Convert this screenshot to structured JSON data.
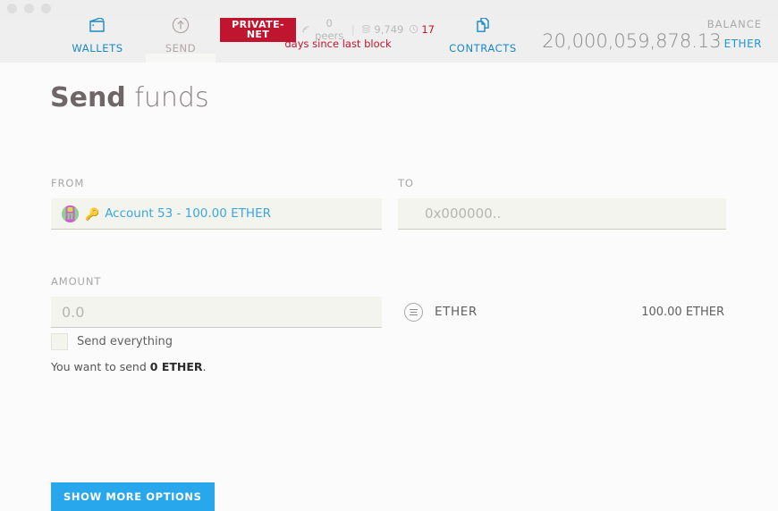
{
  "window": {
    "traffic_lights": [
      "close",
      "minimize",
      "zoom"
    ]
  },
  "header": {
    "nav": [
      {
        "id": "wallets",
        "label": "WALLETS",
        "icon": "wallet-icon",
        "active": false
      },
      {
        "id": "send",
        "label": "SEND",
        "icon": "send-arrow-icon",
        "active": true
      },
      {
        "id": "contracts",
        "label": "CONTRACTS",
        "icon": "documents-icon",
        "active": false
      }
    ],
    "network": {
      "badge": "PRIVATE-NET",
      "peers": "0 peers",
      "peers_icon": "signal-icon",
      "block_number": "9,749",
      "block_icon": "blocks-icon",
      "time_value": "17",
      "time_icon": "clock-icon",
      "since_text": "days since last block",
      "divider": "|"
    },
    "balance": {
      "label": "BALANCE",
      "value": "20,000,059,878.13",
      "unit": "ETHER"
    }
  },
  "page": {
    "title_bold": "Send",
    "title_light": " funds",
    "from": {
      "label": "FROM",
      "account_text": "Account 53 - 100.00 ETHER",
      "key_glyph": "🔑",
      "identicon": "account-identicon"
    },
    "to": {
      "label": "TO",
      "placeholder": "0x000000..",
      "value": ""
    },
    "amount": {
      "label": "AMOUNT",
      "placeholder": "0.0",
      "value": ""
    },
    "send_everything": {
      "label": "Send everything",
      "checked": false
    },
    "summary": {
      "prefix": "You want to send ",
      "value": "0 ETHER",
      "suffix": "."
    },
    "token": {
      "icon": "token-list-icon",
      "name": "ETHER",
      "available": "100.00 ETHER"
    },
    "more_options_button": "SHOW MORE OPTIONS"
  },
  "colors": {
    "accent_blue": "#29a7ed",
    "link_blue": "#3aa7e0",
    "nav_blue": "#1a87c9",
    "danger_red": "#c0152f",
    "header_bg": "#eeefee",
    "page_bg": "#fbfbfb",
    "field_bg": "#f4f4ef"
  }
}
